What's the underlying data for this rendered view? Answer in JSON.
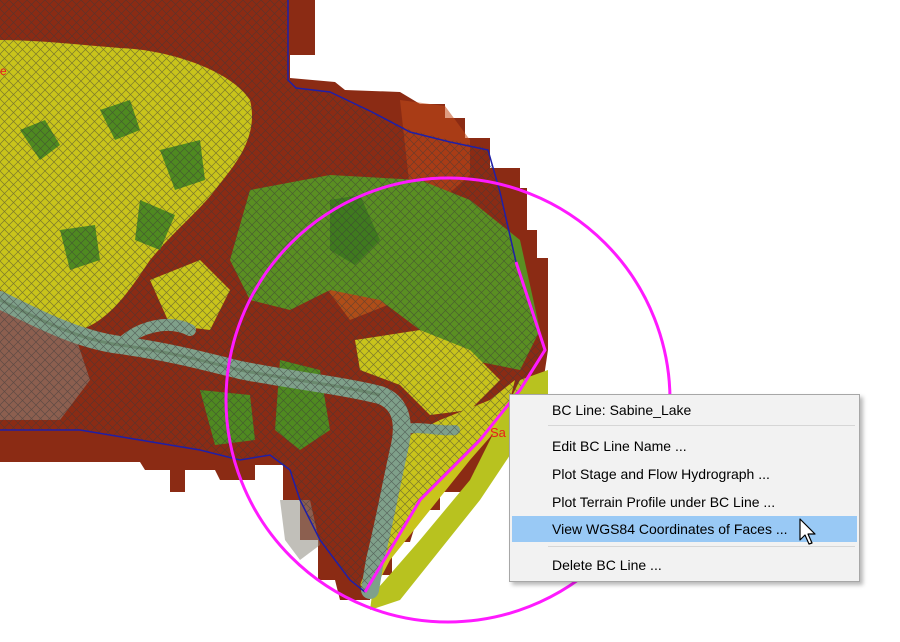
{
  "map": {
    "bc_line_label": "Sa",
    "colors": {
      "mesh_boundary": "#1f1fa8",
      "selection_circle": "#ff1aff",
      "bc_line": "#ff1aff",
      "high_terrain": "#8b2b14",
      "low_vegetation": "#c9c41b",
      "wetland": "#4f8a20",
      "channel": "#7fa08a",
      "mesh_hatch": "#3a3a3a",
      "label_text": "#e8201c"
    }
  },
  "context_menu": {
    "header": "BC Line: Sabine_Lake",
    "items": [
      {
        "label": "Edit BC Line Name ..."
      },
      {
        "label": "Plot Stage and Flow Hydrograph ..."
      },
      {
        "label": "Plot Terrain Profile under BC Line ..."
      },
      {
        "label": "View WGS84 Coordinates of Faces ...",
        "highlighted": true
      },
      {
        "label": "Delete BC Line ..."
      }
    ]
  },
  "cursor": {
    "icon": "arrow-pointer-icon"
  }
}
